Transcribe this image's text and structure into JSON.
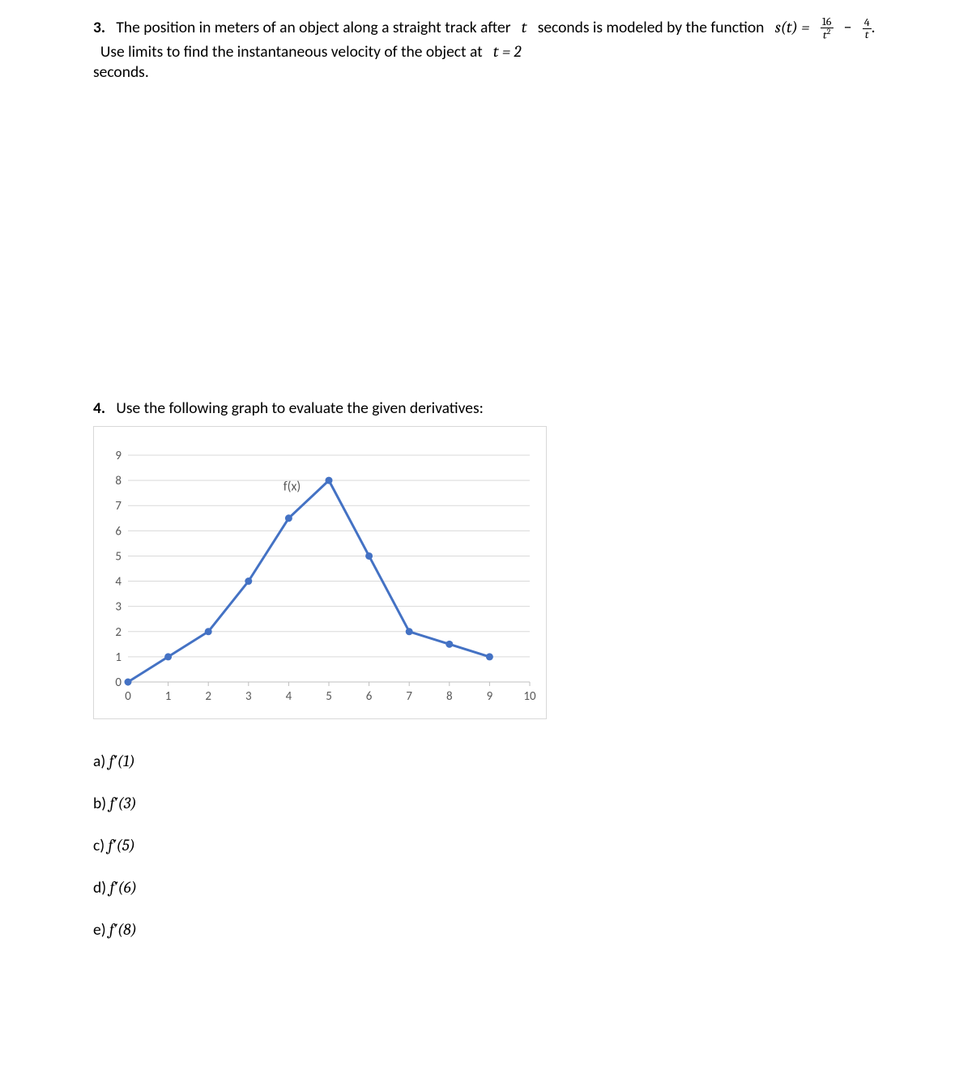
{
  "problem3": {
    "number": "3.",
    "text_before_fn": "The position in meters of an object along a straight track after",
    "var_t": "t",
    "text_after_t": "seconds is modeled by the function",
    "fn_lhs": "s(t) =",
    "frac1_num": "16",
    "frac1_den": "t",
    "frac1_den_sup": "2",
    "minus": "−",
    "frac2_num": "4",
    "frac2_den": "t",
    "period": ".",
    "text_after_fn": "Use limits to find the instantaneous velocity of the object at",
    "eq": "t = 2",
    "text_end": "seconds."
  },
  "problem4": {
    "number": "4.",
    "text": "Use the following graph to evaluate the given derivatives:"
  },
  "chart_data": {
    "type": "line",
    "series_label": "f(x)",
    "x": [
      0,
      1,
      2,
      3,
      4,
      5,
      6,
      7,
      8,
      9
    ],
    "y": [
      0,
      1,
      2,
      4,
      6.5,
      8,
      5,
      2,
      1.5,
      1
    ],
    "xticks": [
      0,
      1,
      2,
      3,
      4,
      5,
      6,
      7,
      8,
      9,
      10
    ],
    "yticks": [
      0,
      1,
      2,
      3,
      4,
      5,
      6,
      7,
      8,
      9
    ],
    "xlim": [
      0,
      10
    ],
    "ylim": [
      0,
      9
    ],
    "line_color": "#4472C4",
    "marker_color": "#4472C4"
  },
  "answers": {
    "a": {
      "prefix": "a)",
      "fn": "f′(1)"
    },
    "b": {
      "prefix": "b)",
      "fn": "f′(3)"
    },
    "c": {
      "prefix": "c)",
      "fn": "f′(5)"
    },
    "d": {
      "prefix": "d)",
      "fn": "f′(6)"
    },
    "e": {
      "prefix": "e)",
      "fn": "f′(8)"
    }
  }
}
